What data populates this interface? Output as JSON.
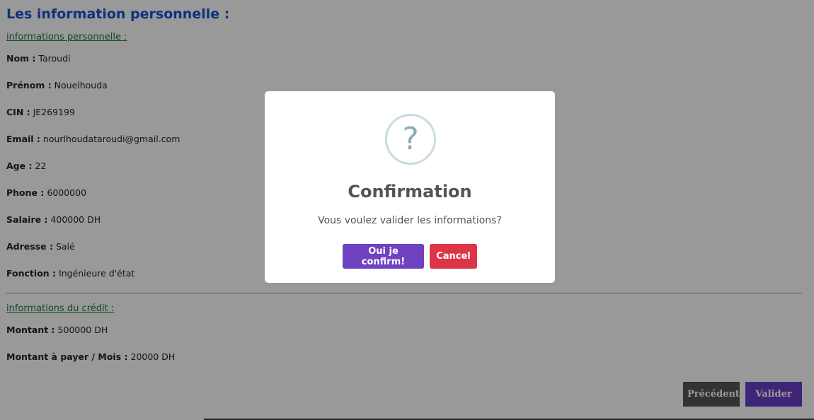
{
  "page": {
    "title": "Les information personnelle :",
    "section_personal": "informations personnelle :",
    "section_credit": "informations du crédit :"
  },
  "personal": [
    {
      "label": "Nom :",
      "value": " Taroudi"
    },
    {
      "label": "Prénom :",
      "value": " Nouelhouda"
    },
    {
      "label": "CIN :",
      "value": " JE269199"
    },
    {
      "label": "Email :",
      "value": " nourlhoudataroudi@gmail.com"
    },
    {
      "label": "Age :",
      "value": " 22"
    },
    {
      "label": "Phone :",
      "value": " 6000000"
    },
    {
      "label": "Salaire :",
      "value": " 400000 DH"
    },
    {
      "label": "Adresse :",
      "value": " Salé"
    },
    {
      "label": "Fonction :",
      "value": " Ingénieure d'état"
    }
  ],
  "credit": [
    {
      "label": "Montant :",
      "value": " 500000 DH"
    },
    {
      "label": "Montant à payer / Mois :",
      "value": " 20000 DH"
    }
  ],
  "buttons": {
    "previous": "Précédente",
    "submit": "Valider"
  },
  "modal": {
    "icon": "?",
    "title": "Confirmation",
    "text": "Vous voulez valider les informations?",
    "confirm": "Oui je confirm!",
    "cancel": "Cancel"
  },
  "colors": {
    "title": "#1a53d6",
    "section_link": "#1e7a3c",
    "confirm": "#6f42c1",
    "cancel": "#dc3545"
  }
}
